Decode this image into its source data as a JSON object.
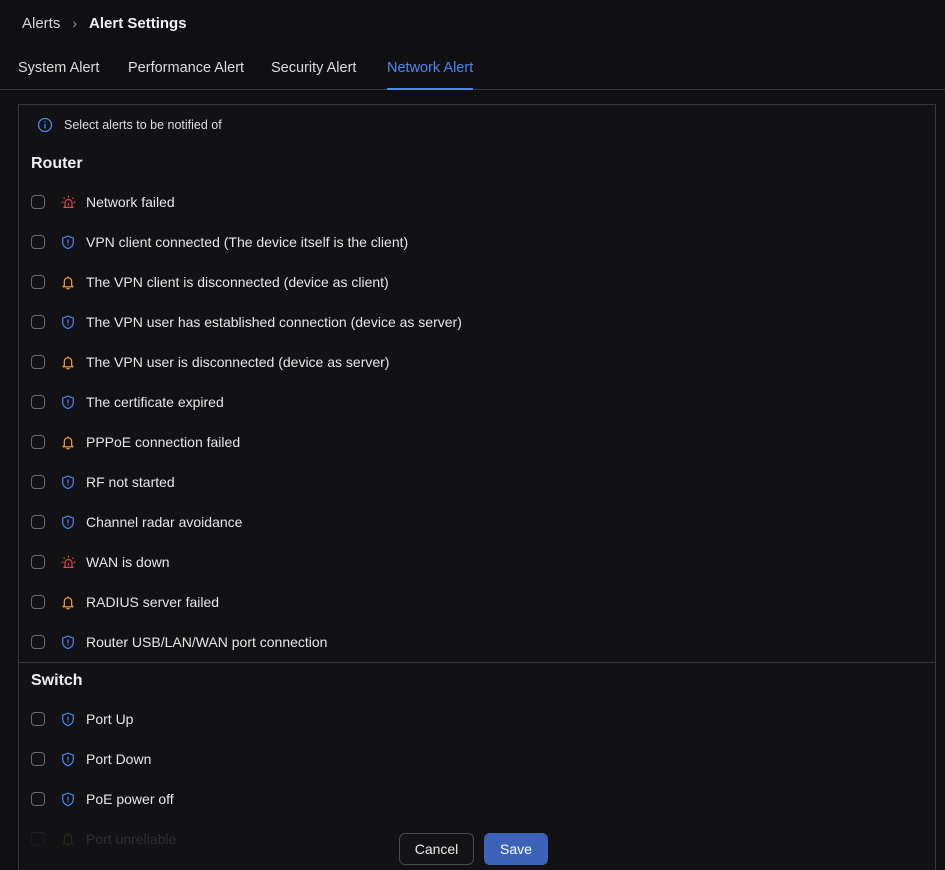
{
  "breadcrumb": {
    "parent": "Alerts",
    "separator": "›",
    "current": "Alert Settings"
  },
  "tabs": [
    {
      "label": "System Alert",
      "active": false
    },
    {
      "label": "Performance Alert",
      "active": false
    },
    {
      "label": "Security Alert",
      "active": false
    },
    {
      "label": "Network Alert",
      "active": true
    }
  ],
  "info_text": "Select alerts to be notified of",
  "colors": {
    "accent": "#4d86f5",
    "critical": "#e0484b",
    "warning": "#f0a23a",
    "info": "#4d86f5",
    "save_button": "#3d63b8"
  },
  "sections": [
    {
      "title": "Router",
      "items": [
        {
          "label": "Network failed",
          "icon": "siren-icon",
          "checked": false
        },
        {
          "label": "VPN client connected (The device itself is the client)",
          "icon": "shield-icon",
          "checked": false
        },
        {
          "label": "The VPN client is disconnected (device as client)",
          "icon": "bell-icon",
          "checked": false
        },
        {
          "label": "The VPN user has established connection (device as server)",
          "icon": "shield-icon",
          "checked": false
        },
        {
          "label": "The VPN user is disconnected (device as server)",
          "icon": "bell-icon",
          "checked": false
        },
        {
          "label": "The certificate expired",
          "icon": "shield-icon",
          "checked": false
        },
        {
          "label": "PPPoE connection failed",
          "icon": "bell-icon",
          "checked": false
        },
        {
          "label": "RF not started",
          "icon": "shield-icon",
          "checked": false
        },
        {
          "label": "Channel radar avoidance",
          "icon": "shield-icon",
          "checked": false
        },
        {
          "label": "WAN is down",
          "icon": "siren-icon",
          "checked": false
        },
        {
          "label": "RADIUS server failed",
          "icon": "bell-icon",
          "checked": false
        },
        {
          "label": "Router USB/LAN/WAN port connection",
          "icon": "shield-icon",
          "checked": false
        }
      ]
    },
    {
      "title": "Switch",
      "items": [
        {
          "label": "Port Up",
          "icon": "shield-icon",
          "checked": false
        },
        {
          "label": "Port Down",
          "icon": "shield-icon",
          "checked": false
        },
        {
          "label": "PoE power off",
          "icon": "shield-icon",
          "checked": false
        },
        {
          "label": "Port unreliable",
          "icon": "bell-icon",
          "checked": false
        }
      ]
    }
  ],
  "buttons": {
    "cancel": "Cancel",
    "save": "Save"
  }
}
